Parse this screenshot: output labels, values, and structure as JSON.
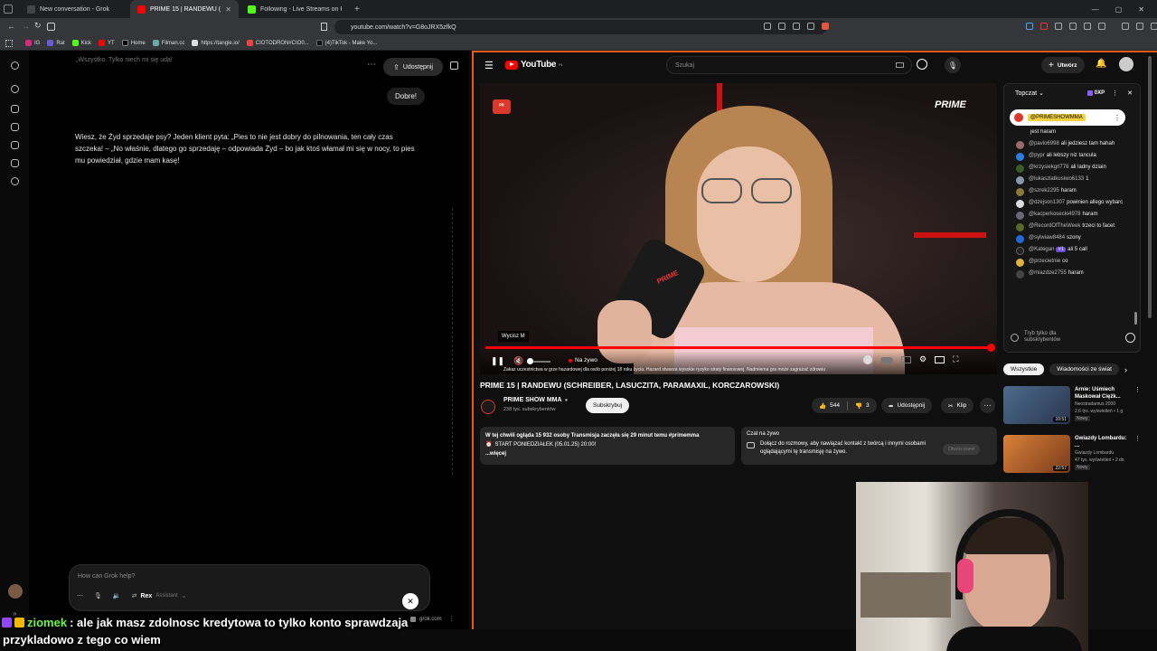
{
  "browser": {
    "tabs": [
      {
        "label": "New conversation - Grok",
        "icon": "grok-icon"
      },
      {
        "label": "PRIME 15 | RANDEWU (SCHR",
        "icon": "youtube-icon",
        "active": true
      },
      {
        "label": "Following - Live Streams on Kick",
        "icon": "kick-icon"
      }
    ],
    "url": "youtube.com/watch?v=G8oJRX5zfkQ",
    "bookmarks": [
      "IG",
      "Rat",
      "Kick",
      "YT",
      "Home",
      "Filman.cc",
      "https://tangle.io/",
      "CIOTODRON#CIO0...",
      "(4)TikTok - Make Yo..."
    ]
  },
  "grok": {
    "top_text": "„Wszystko. Tylko niech mi się uda!",
    "share_label": "Udostępnij",
    "user_message": "Dobre!",
    "assistant_message": "Wiesz, że Żyd sprzedaje psy? Jeden klient pyta: „Pies to nie jest dobry do pilnowania, ten cały czas szczeka! – „No właśnie, dlatego go sprzedaję – odpowiada Żyd – bo jak ktoś włamał mi się w nocy, to pies mu powiedział, gdzie mam kasę!",
    "composer_placeholder": "How can Grok help?",
    "model_label": "Rex",
    "model_sub": "Assistant",
    "footer": "grok.com"
  },
  "youtube": {
    "logo": "YouTube",
    "logo_region": "PL",
    "search_placeholder": "Szukaj",
    "create_label": "Utwórz",
    "video_overlay_brand": "PRIME",
    "tooltip": "Wycisz  M",
    "live_label": "Na żywo",
    "warning_text": "Zakaz uczestnictwa w grze hazardowej dla osób poniżej 18 roku życia. Hazard stwarza wysokie ryzyko straty finansowej. Nadmierna gra może zagrażać zdrowiu",
    "title": "PRIME 15 | RANDEWU (SCHREIBER, LASUCZITA, PARAMAXIL, KORCZAROWSKI)",
    "channel": "PRIME SHOW MMA",
    "subscribers": "238 tys. subskrybentów",
    "subscribe_label": "Subskrybuj",
    "likes": "544",
    "dislikes": "3",
    "share_label": "Udostępnij",
    "clip_label": "Klip",
    "description_line1": "W tej chwili ogląda 15 932 osoby  Transmisja zaczęła się 29 minut temu  #primemma",
    "description_line2": "START PONIEDZIAŁEK (05.01.25) 20:00!",
    "description_more": "...więcej",
    "livechat_title": "Czat na żywo",
    "livechat_text": "Dołącz do rozmowy, aby nawiązać kontakt z twórcą i innymi osobami oglądającymi tę transmisję na żywo.",
    "livechat_button": "Otwórz panel",
    "chat_header": "Topczat",
    "chat_points": "0XP",
    "pinned": "@PRIMESHOWMMA",
    "chat": [
      {
        "user": "",
        "msg": "jest haram"
      },
      {
        "user": "@pavlo6998",
        "msg": "ali jedziesz tam hahah"
      },
      {
        "user": "@pypr",
        "msg": "ali lebszy niz tancula"
      },
      {
        "user": "@krzysiekgrl776",
        "msg": "ali ladny dziain"
      },
      {
        "user": "@lukaszlatkusiwo6133",
        "msg": "1"
      },
      {
        "user": "@szrek2295",
        "msg": "haram"
      },
      {
        "user": "@dzejson1307",
        "msg": "powinien allego wybarc"
      },
      {
        "user": "@kacperkosecki4978",
        "msg": "haram"
      },
      {
        "user": "@RecordOfTheWeek",
        "msg": "trzeci to facet"
      },
      {
        "user": "@sylwiaw8484",
        "msg": "szony"
      },
      {
        "user": "@Kategan",
        "msg": "ali 5 call",
        "badge": "#1"
      },
      {
        "user": "@przecietnie",
        "msg": "co"
      },
      {
        "user": "@miazdze2755",
        "msg": "haram"
      }
    ],
    "chat_subs_only": "Tryb tylko dla subskrybentów",
    "rec_tabs": [
      "Wszystkie",
      "Wiadomości ze świat"
    ],
    "recommendations": [
      {
        "title": "Arnie: Uśmiech Maskował Ciężk...",
        "channel": "Neostradamus 2000",
        "meta": "2,6 tys. wyświetleń • 1 g",
        "badge": "Nowy",
        "duration": "10:51",
        "color": "#3a4a6a"
      },
      {
        "title": "Gwiazdy Lombardu: ...",
        "channel": "Gwiazdy Lombardu",
        "meta": "47 tys. wyświetleń • 2 dn",
        "badge": "Nowy",
        "duration": "22:57",
        "color": "#b8582a"
      }
    ]
  },
  "stream_overlay": {
    "user": "ziomek",
    "message_line1": ": ale jak masz zdolnosc kredytowa to tylko konto sprawdzaja",
    "message_line2": "przykladowo z tego co wiem"
  }
}
